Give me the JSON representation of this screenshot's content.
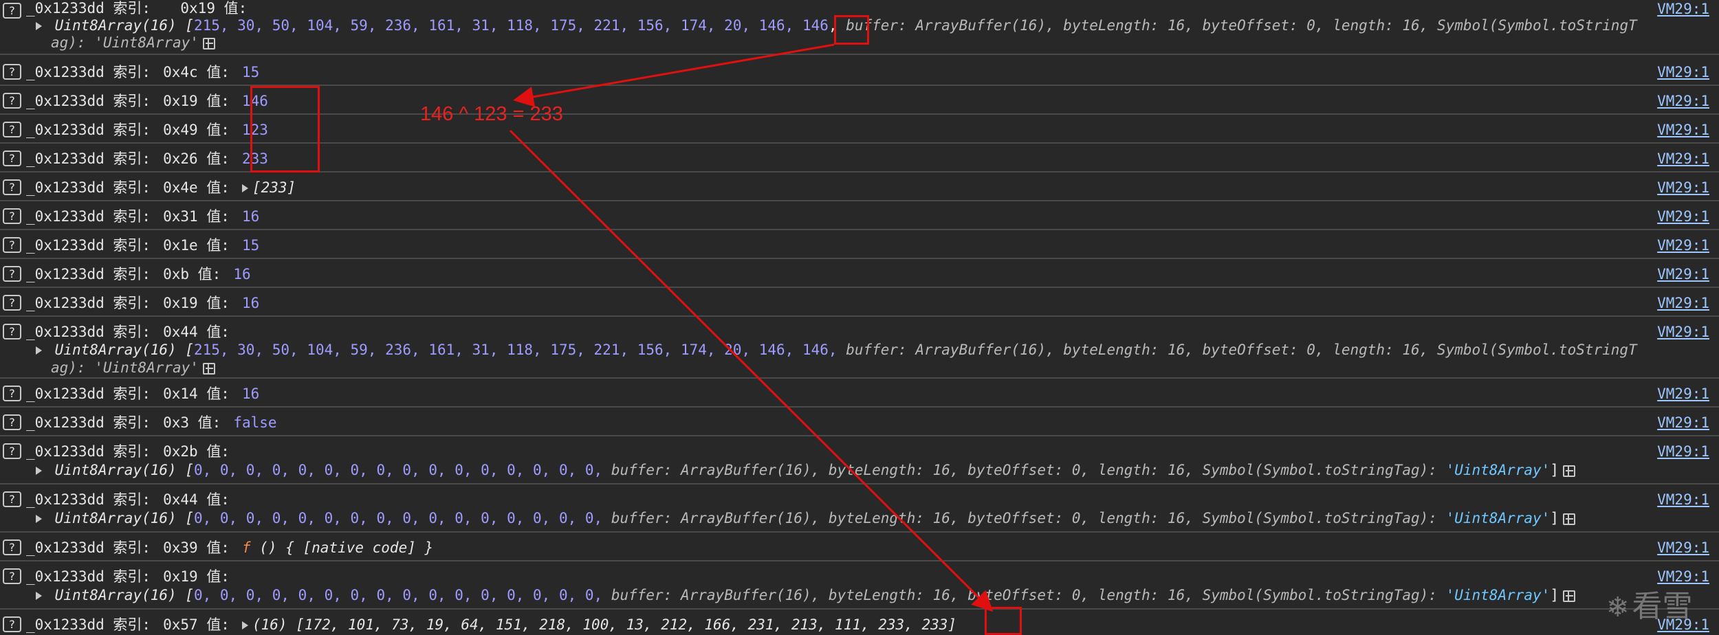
{
  "source_link": "VM29:1",
  "icon_char": "?",
  "entry_label": "_0x1233dd 索引:",
  "value_label": "值:",
  "entries": [
    {
      "idx": "0x19"
    },
    {
      "idx": "0x4c",
      "val": "15"
    },
    {
      "idx": "0x19",
      "val": "146"
    },
    {
      "idx": "0x49",
      "val": "123"
    },
    {
      "idx": "0x26",
      "val": "233"
    },
    {
      "idx": "0x4e",
      "val": "[233]"
    },
    {
      "idx": "0x31",
      "val": "16"
    },
    {
      "idx": "0x1e",
      "val": "15"
    },
    {
      "idx": "0xb",
      "val": "16"
    },
    {
      "idx": "0x19",
      "val": "16"
    },
    {
      "idx": "0x44"
    },
    {
      "idx": "0x14",
      "val": "16"
    },
    {
      "idx": "0x3",
      "val": "false"
    },
    {
      "idx": "0x2b"
    },
    {
      "idx": "0x44"
    },
    {
      "idx": "0x39",
      "val_prefix": "f",
      "val": "() { [native code] }"
    },
    {
      "idx": "0x19"
    },
    {
      "idx": "0x57",
      "val": "(16) [172, 101, 73, 19, 64, 151, 218, 100, 13, 212, 166, 231, 213, 111, 233, 233]"
    }
  ],
  "uint8_array_1": {
    "type": "Uint8Array(16) [",
    "values": "215, 30, 50, 104, 59, 236, 161, 31, 118, 175, 221, 156, 174, 20, 146,",
    "highlight": "146",
    "tail": "buffer: ArrayBuffer(16), byteLength: 16, byteOffset: 0, length: 16, Symbol(Symbol.toStringT",
    "wrap": "ag): 'Uint8Array'"
  },
  "uint8_array_2": {
    "type": "Uint8Array(16) [",
    "values": "215, 30, 50, 104, 59, 236, 161, 31, 118, 175, 221, 156, 174, 20, 146, 146,",
    "tail": "buffer: ArrayBuffer(16), byteLength: 16, byteOffset: 0, length: 16, Symbol(Symbol.toStringT",
    "wrap": "ag): 'Uint8Array'"
  },
  "uint8_zero": {
    "type": "Uint8Array(16) [",
    "values": "0, 0, 0, 0, 0, 0, 0, 0, 0, 0, 0, 0, 0, 0, 0, 0,",
    "tail": "buffer: ArrayBuffer(16), byteLength: 16, byteOffset: 0, length: 16, Symbol(Symbol.toStringTag):",
    "tag": "'Uint8Array'"
  },
  "annotation": {
    "text": "146 ^ 123 = 233",
    "color": "#e01010"
  },
  "watermark": {
    "text": "看雪",
    "flake": "❄"
  }
}
